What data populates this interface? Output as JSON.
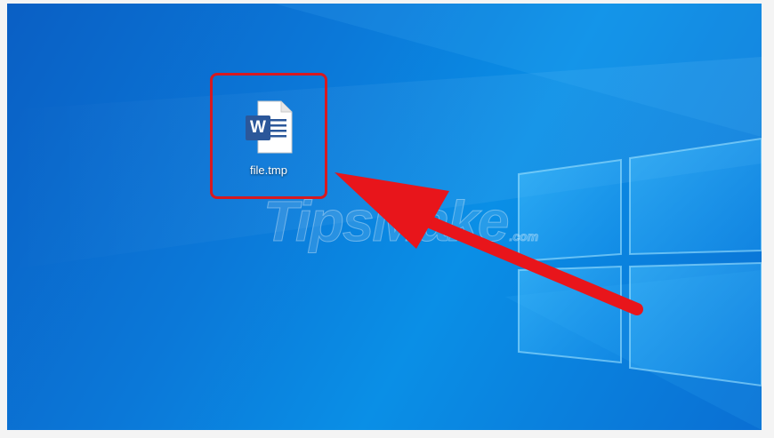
{
  "desktop": {
    "icons": [
      {
        "label": "file.tmp",
        "icon": "word-document-icon",
        "app_badge": "W",
        "highlighted": true
      }
    ]
  },
  "watermark": {
    "main": "TipsMake",
    "suffix": ".com"
  },
  "colors": {
    "highlight": "#d71920",
    "arrow": "#e8151b",
    "word_blue": "#2b579a"
  }
}
